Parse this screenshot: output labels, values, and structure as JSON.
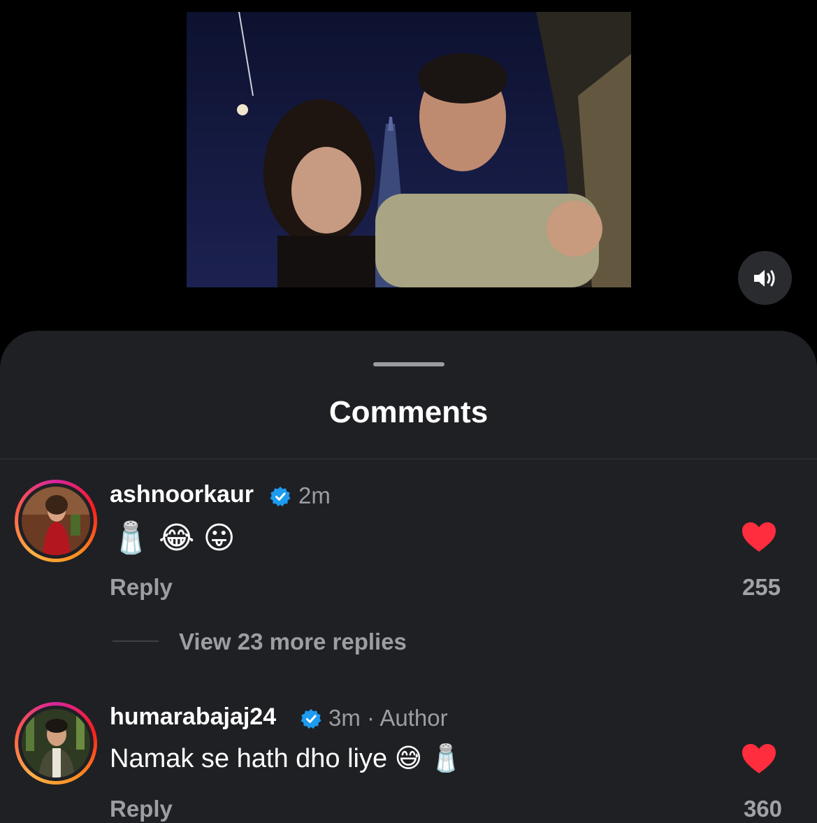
{
  "sheet": {
    "title": "Comments"
  },
  "comments": [
    {
      "username": "ashnoorkaur",
      "time": "2m",
      "author_tag": "",
      "text": "🧂 😂 😛",
      "reply_label": "Reply",
      "likes": "255",
      "liked": true,
      "view_replies": "View 23 more replies"
    },
    {
      "username": "humarabajaj24",
      "time": "3m",
      "author_tag": "Author",
      "text": "Namak se hath dho liye 😅 🧂",
      "reply_label": "Reply",
      "likes": "360",
      "liked": true
    }
  ],
  "colors": {
    "sheet_bg": "#1f2024",
    "like_red": "#ff2d3d",
    "verified_blue": "#1d9bf0"
  },
  "icons": {
    "mute": "speaker-on-icon",
    "verified": "verified-badge-icon",
    "like": "heart-filled-icon"
  }
}
